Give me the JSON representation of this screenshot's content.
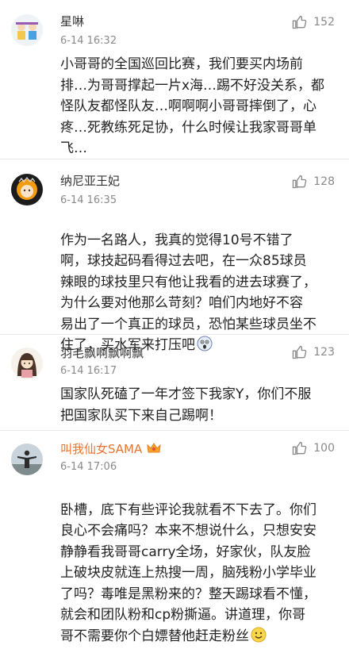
{
  "comments": [
    {
      "user": "星啉",
      "time": "6-14 16:32",
      "likes": "152",
      "text": "小哥哥的全国巡回比赛，我们要买内场前\n排…为哥哥撑起一片x海…踢不好没关系，都\n怪队友都怪队友…啊啊啊小哥哥摔倒了，心\n疼…死教练死足协，什么时候让我家哥哥单\n飞…",
      "avatar_icon": "cartoon-avatar-icon"
    },
    {
      "user": "纳尼亚王妃",
      "time": "6-14 16:35",
      "likes": "128",
      "text": "作为一名路人，我真的觉得10号不错了\n啊，球技起码看得过去吧，在一众85球员\n辣眼的球技里只有他让我看的进去球赛了，\n为什么要对他那么苛刻？咱们内地好不容\n易出了一个真正的球员，恐怕某些球员坐不\n住了，买水军来打压吧",
      "trailing_emoji": "shocked-face-emoji",
      "avatar_icon": "orange-girl-avatar-icon"
    },
    {
      "user": "羽毛飘啊飘啊飘",
      "time": "6-14 16:17",
      "likes": "123",
      "text": "国家队死磕了一年才签下我家Y，你们不服\n把国家队买下来自己踢啊！",
      "avatar_icon": "long-hair-girl-avatar-icon"
    },
    {
      "user": "叫我仙女SAMA",
      "time": "6-14 17:06",
      "likes": "100",
      "text": "卧槽，底下有些评论我就看不下去了。你们\n良心不会痛吗？本来不想说什么，只想安安\n静静看我哥哥carry全场，好家伙，队友脸\n上破块皮就连上热搜一周，脑残粉小学毕业\n了吗？毒唯是黑粉来的？整天踢球看不懂，\n就会和团队粉和cp粉撕逼。讲道理，你哥\n哥不需要你个白嫖替他赶走粉丝",
      "trailing_emoji": "smiley-face-emoji",
      "badge_icon": "vip-badge-icon",
      "avatar_icon": "silhouette-person-avatar-icon"
    }
  ],
  "colors": {
    "name": "#333333",
    "vip_name": "#e8742e",
    "meta": "#8a8a8a",
    "text": "#222222",
    "divider": "#e6e6e6"
  }
}
